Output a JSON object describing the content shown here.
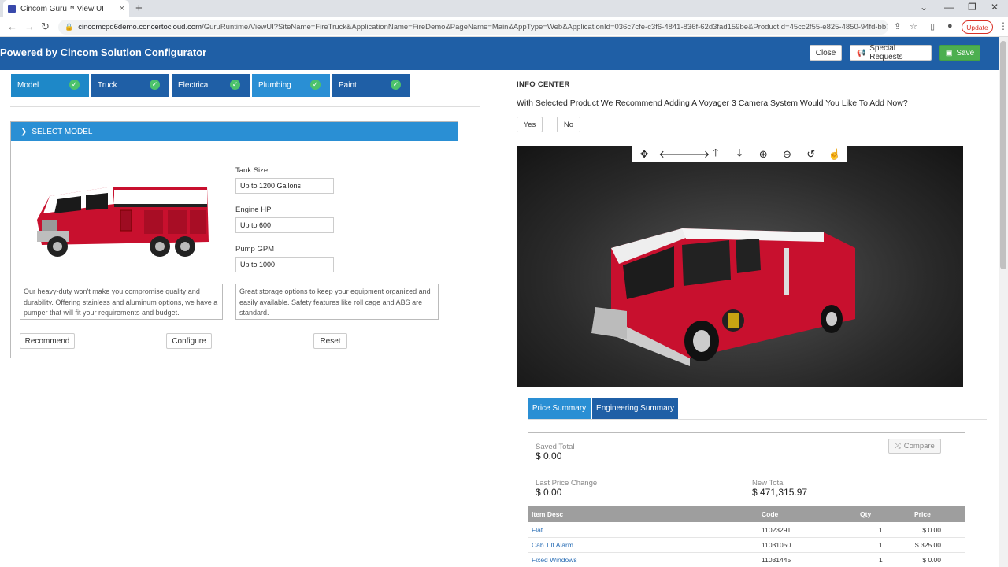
{
  "browser": {
    "tab_title": "Cincom Guru™ View UI",
    "tab_close": "×",
    "new_tab": "+",
    "url_host": "cincomcpq6demo.concertocloud.com",
    "url_rest": "/GuruRuntime/ViewUI?SiteName=FireTruck&ApplicationName=FireDemo&PageName=Main&AppType=Web&ApplicationId=036c7cfe-c3f6-4841-836f-62d3fad159be&ProductId=45cc2f55-e825-4850-94fd-bb7...",
    "update_label": "Update"
  },
  "header": {
    "title": "Powered by Cincom Solution Configurator",
    "close_label": "Close",
    "special_label": "Special Requests",
    "save_label": "Save"
  },
  "steps": [
    {
      "label": "Model"
    },
    {
      "label": "Truck"
    },
    {
      "label": "Electrical"
    },
    {
      "label": "Plumbing"
    },
    {
      "label": "Paint"
    }
  ],
  "panel": {
    "title": "SELECT MODEL",
    "tank_label": "Tank Size",
    "tank_value": "Up to 1200 Gallons",
    "engine_label": "Engine HP",
    "engine_value": "Up to 600",
    "pump_label": "Pump GPM",
    "pump_value": "Up to 1000",
    "desc_left": "Our heavy-duty won't make you compromise quality and durability.  Offering stainless and aluminum options, we have a pumper that will fit your requirements and budget.",
    "desc_right": "Great storage options to keep your equipment organized and easily available.  Safety features like roll cage and ABS are standard.",
    "recommend_label": "Recommend",
    "configure_label": "Configure",
    "reset_label": "Reset"
  },
  "info": {
    "title": "INFO CENTER",
    "question": "With Selected Product We Recommend Adding A Voyager 3 Camera System Would You Like To Add Now?",
    "yes_label": "Yes",
    "no_label": "No"
  },
  "viewer_icons": [
    "move-icon",
    "arrow-left-icon",
    "arrow-right-icon",
    "arrow-up-icon",
    "arrow-down-icon",
    "zoom-in-icon",
    "zoom-out-icon",
    "reset-icon",
    "hand-icon"
  ],
  "summary": {
    "tab_price": "Price Summary",
    "tab_engineering": "Engineering Summary",
    "compare_label": "Compare",
    "saved_total_label": "Saved Total",
    "saved_total_value": "$ 0.00",
    "last_change_label": "Last Price Change",
    "last_change_value": "$ 0.00",
    "new_total_label": "New Total",
    "new_total_value": "$ 471,315.97",
    "columns": {
      "desc": "Item Desc",
      "code": "Code",
      "qty": "Qty",
      "price": "Price"
    },
    "rows": [
      {
        "desc": "Flat",
        "code": "11023291",
        "qty": "1",
        "price": "$ 0.00"
      },
      {
        "desc": "Cab Tilt Alarm",
        "code": "11031050",
        "qty": "1",
        "price": "$ 325.00"
      },
      {
        "desc": "Fixed Windows",
        "code": "11031445",
        "qty": "1",
        "price": "$ 0.00"
      }
    ]
  },
  "colors": {
    "header_blue": "#1f5fa6",
    "accent_blue": "#2a8fd4",
    "save_green": "#4caf50",
    "check_green": "#4cc26c",
    "truck_red": "#c8102e"
  }
}
